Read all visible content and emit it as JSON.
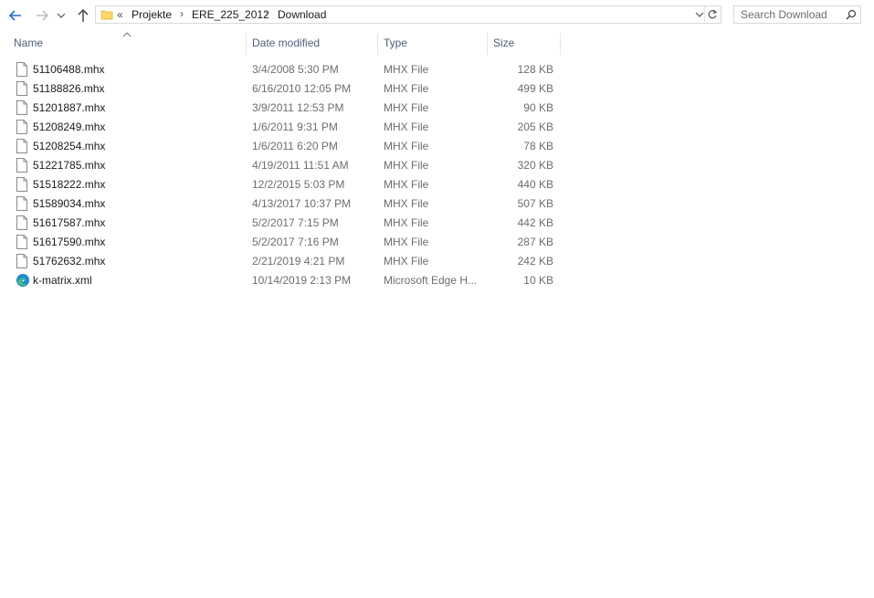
{
  "breadcrumb": {
    "overflow": "«",
    "items": [
      "Projekte",
      "ERE_225_2012",
      "Download"
    ]
  },
  "search": {
    "placeholder": "Search Download"
  },
  "columns": {
    "name": "Name",
    "date_modified": "Date modified",
    "type": "Type",
    "size": "Size"
  },
  "files": [
    {
      "name": "51106488.mhx",
      "date": "3/4/2008 5:30 PM",
      "type": "MHX File",
      "size": "128 KB",
      "icon": "document-icon"
    },
    {
      "name": "51188826.mhx",
      "date": "6/16/2010 12:05 PM",
      "type": "MHX File",
      "size": "499 KB",
      "icon": "document-icon"
    },
    {
      "name": "51201887.mhx",
      "date": "3/9/2011 12:53 PM",
      "type": "MHX File",
      "size": "90 KB",
      "icon": "document-icon"
    },
    {
      "name": "51208249.mhx",
      "date": "1/6/2011 9:31 PM",
      "type": "MHX File",
      "size": "205 KB",
      "icon": "document-icon"
    },
    {
      "name": "51208254.mhx",
      "date": "1/6/2011 6:20 PM",
      "type": "MHX File",
      "size": "78 KB",
      "icon": "document-icon"
    },
    {
      "name": "51221785.mhx",
      "date": "4/19/2011 11:51 AM",
      "type": "MHX File",
      "size": "320 KB",
      "icon": "document-icon"
    },
    {
      "name": "51518222.mhx",
      "date": "12/2/2015 5:03 PM",
      "type": "MHX File",
      "size": "440 KB",
      "icon": "document-icon"
    },
    {
      "name": "51589034.mhx",
      "date": "4/13/2017 10:37 PM",
      "type": "MHX File",
      "size": "507 KB",
      "icon": "document-icon"
    },
    {
      "name": "51617587.mhx",
      "date": "5/2/2017 7:15 PM",
      "type": "MHX File",
      "size": "442 KB",
      "icon": "document-icon"
    },
    {
      "name": "51617590.mhx",
      "date": "5/2/2017 7:16 PM",
      "type": "MHX File",
      "size": "287 KB",
      "icon": "document-icon"
    },
    {
      "name": "51762632.mhx",
      "date": "2/21/2019 4:21 PM",
      "type": "MHX File",
      "size": "242 KB",
      "icon": "document-icon"
    },
    {
      "name": "k-matrix.xml",
      "date": "10/14/2019 2:13 PM",
      "type": "Microsoft Edge H...",
      "size": "10 KB",
      "icon": "edge-icon"
    }
  ],
  "colors": {
    "accent": "#1e6fd9",
    "header_text": "#4c607a",
    "muted_text": "#6d6d6d",
    "border": "#d9d9d9"
  }
}
